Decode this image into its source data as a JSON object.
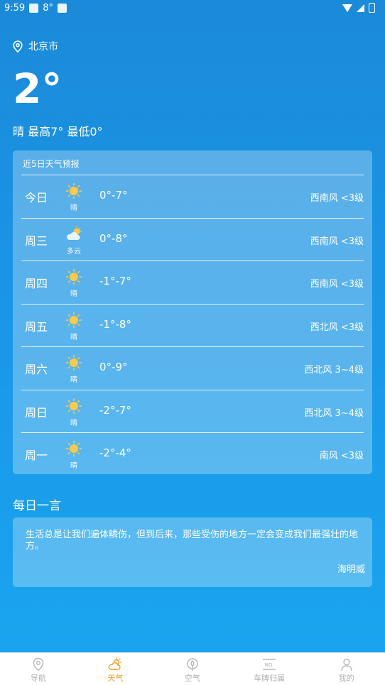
{
  "status_bar": {
    "time": "9:59",
    "temp": "8°"
  },
  "location": {
    "city": "北京市"
  },
  "current": {
    "temp": "2°",
    "summary": "晴  最高7° 最低0°"
  },
  "forecast": {
    "title": "近5日天气预报",
    "days": [
      {
        "day": "今日",
        "icon": "sunny-icon",
        "cond": "晴",
        "temp": "0°-7°",
        "wind": "西南风 <3级"
      },
      {
        "day": "周三",
        "icon": "cloudy-icon",
        "cond": "多云",
        "temp": "0°-8°",
        "wind": "西南风 <3级"
      },
      {
        "day": "周四",
        "icon": "sunny-icon",
        "cond": "晴",
        "temp": "-1°-7°",
        "wind": "西南风 <3级"
      },
      {
        "day": "周五",
        "icon": "sunny-icon",
        "cond": "晴",
        "temp": "-1°-8°",
        "wind": "西北风 <3级"
      },
      {
        "day": "周六",
        "icon": "sunny-icon",
        "cond": "晴",
        "temp": "0°-9°",
        "wind": "西北风 3~4级"
      },
      {
        "day": "周日",
        "icon": "sunny-icon",
        "cond": "晴",
        "temp": "-2°-7°",
        "wind": "西北风 3~4级"
      },
      {
        "day": "周一",
        "icon": "sunny-icon",
        "cond": "晴",
        "temp": "-2°-4°",
        "wind": "南风 <3级"
      }
    ]
  },
  "quote": {
    "heading": "每日一言",
    "text": "生活总是让我们遍体鳞伤，但到后来，那些受伤的地方一定会变成我们最强壮的地方。",
    "author": "海明威"
  },
  "nav": [
    {
      "label": "导航",
      "icon": "map-pin-icon",
      "active": false
    },
    {
      "label": "天气",
      "icon": "weather-icon",
      "active": true
    },
    {
      "label": "空气",
      "icon": "leaf-icon",
      "active": false
    },
    {
      "label": "车牌归属",
      "icon": "license-plate-icon",
      "active": false
    },
    {
      "label": "我的",
      "icon": "user-icon",
      "active": false
    }
  ],
  "colors": {
    "accent": "#f39c2d",
    "background": "#1a96e6",
    "sun": "#ffc94a"
  }
}
